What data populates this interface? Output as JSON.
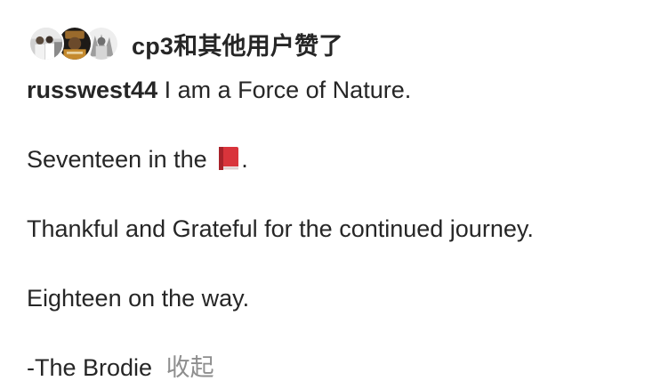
{
  "likes": {
    "text": "cp3和其他用户赞了",
    "avatars": [
      "avatar-1",
      "avatar-2",
      "avatar-3"
    ]
  },
  "post": {
    "username": "russwest44",
    "lines": [
      "I am a Force of Nature.",
      "Seventeen in the",
      "Thankful and Grateful for the continued journey.",
      "Eighteen on the way.",
      "-The Brodie"
    ],
    "book_suffix": ".",
    "book_icon": "red-book-emoji",
    "collapse_label": "收起"
  },
  "colors": {
    "text": "#262626",
    "muted": "#8e8e8e",
    "book": "#d9343b"
  }
}
